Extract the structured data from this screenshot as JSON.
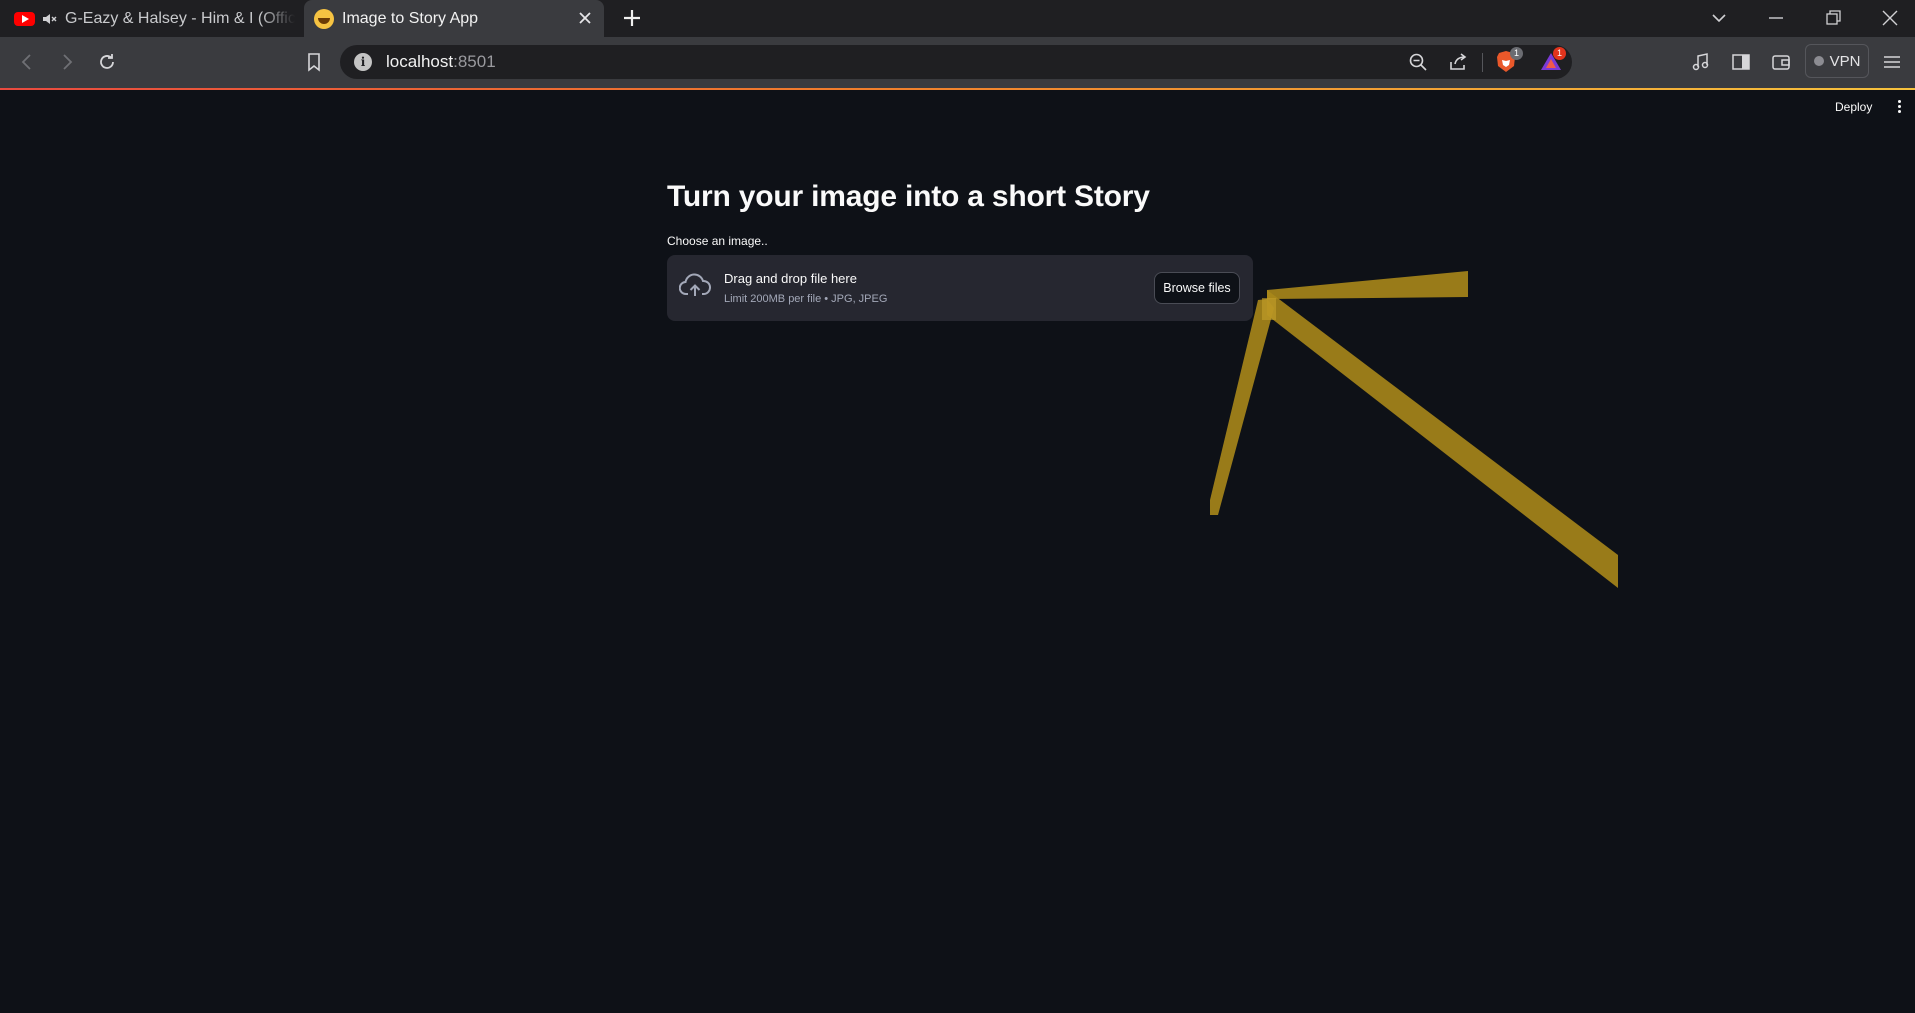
{
  "browser": {
    "tabs": [
      {
        "title": "G-Eazy & Halsey - Him & I (Officia",
        "active": false,
        "favicon": "youtube-icon",
        "audio": "muted-speaker-icon"
      },
      {
        "title": "Image to Story App",
        "active": true,
        "favicon": "grinning-emoji-icon"
      }
    ],
    "address": {
      "host": "localhost",
      "port": ":8501"
    },
    "shields_count": "1",
    "rewards_count": "1",
    "vpn_label": "VPN"
  },
  "app": {
    "deploy_label": "Deploy",
    "title": "Turn your image into a short Story",
    "uploader": {
      "label": "Choose an image..",
      "drag_text": "Drag and drop file here",
      "limit_text": "Limit 200MB per file • JPG, JPEG",
      "browse_label": "Browse files"
    }
  },
  "colors": {
    "page_bg": "#0e1117",
    "dropzone_bg": "#262730",
    "annotation_arrow": "#a8871a"
  }
}
